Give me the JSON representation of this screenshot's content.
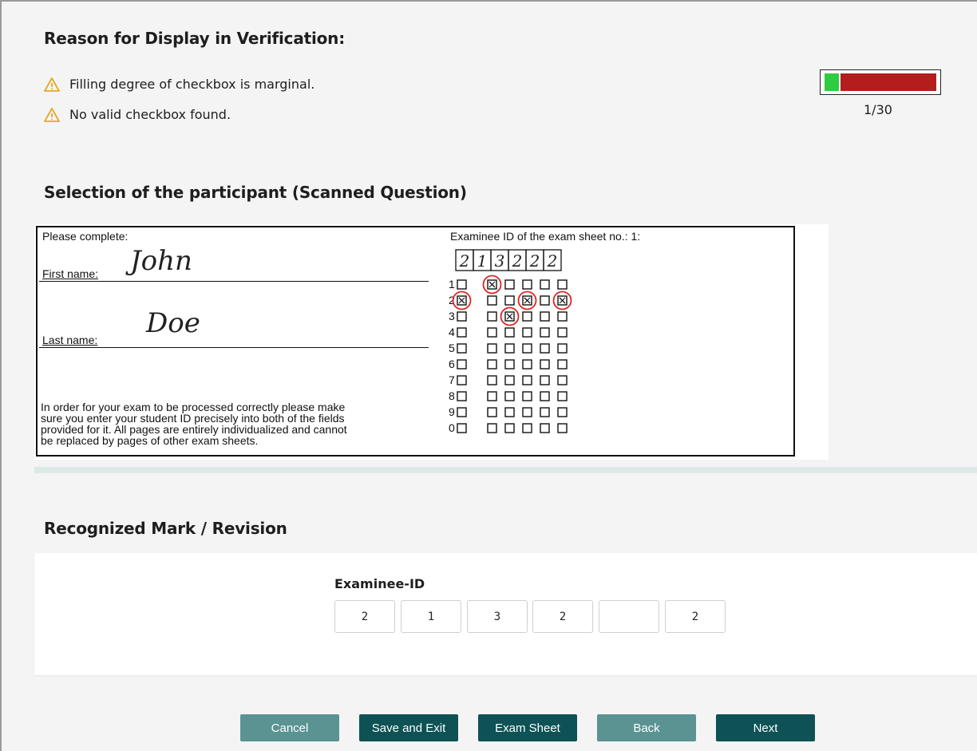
{
  "reason": {
    "title": "Reason for Display in Verification:",
    "items": [
      {
        "icon": "warning-icon",
        "text": "Filling degree of checkbox is marginal."
      },
      {
        "icon": "warning-icon",
        "text": "No valid checkbox found."
      }
    ]
  },
  "progress": {
    "current": 1,
    "total": 30,
    "label": "1/30",
    "fraction": 0.033,
    "ok_color": "#2ecc40",
    "remaining_color": "#b31d1d"
  },
  "selection": {
    "title": "Selection of the participant (Scanned Question)",
    "scan": {
      "please_complete": "Please complete:",
      "first_name_label": "First name:",
      "first_name_value": "John",
      "last_name_label": "Last name:",
      "last_name_value": "Doe",
      "instructions": [
        "In order for your exam to be processed correctly please make",
        "sure you enter your student ID precisely into both of the fields",
        "provided for it. All pages are entirely individualized and cannot",
        "be replaced by pages of other exam sheets."
      ],
      "examinee_header": "Examinee ID of the exam sheet no.: 1:",
      "handwritten_digits": [
        "2",
        "1",
        "3",
        "2",
        "2",
        "2"
      ],
      "row_labels": [
        "1",
        "2",
        "3",
        "4",
        "5",
        "6",
        "7",
        "8",
        "9",
        "0"
      ],
      "marked": [
        [
          0,
          1
        ],
        [
          1,
          0
        ],
        [
          1,
          3
        ],
        [
          1,
          5
        ],
        [
          2,
          2
        ]
      ],
      "circled": [
        [
          0,
          1
        ],
        [
          1,
          0
        ],
        [
          1,
          3
        ],
        [
          1,
          5
        ],
        [
          2,
          2
        ]
      ],
      "highlight_color": "#e02020"
    }
  },
  "revision": {
    "title": "Recognized Mark / Revision",
    "examinee_label": "Examinee-ID",
    "cells": [
      "2",
      "1",
      "3",
      "2",
      "",
      "2"
    ]
  },
  "buttons": {
    "cancel": "Cancel",
    "save_exit": "Save and Exit",
    "exam_sheet": "Exam Sheet",
    "back": "Back",
    "next": "Next"
  }
}
